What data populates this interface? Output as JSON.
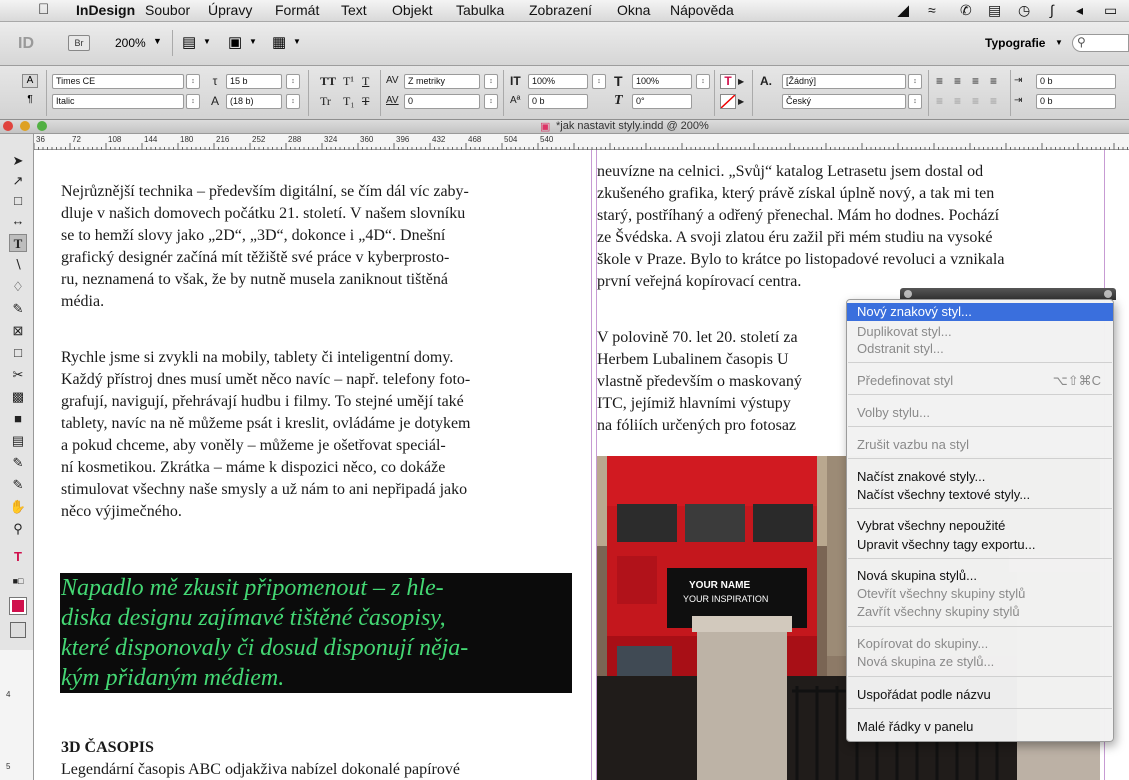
{
  "menubar": {
    "apple": "",
    "items": [
      "InDesign",
      "Soubor",
      "Úpravy",
      "Formát",
      "Text",
      "Objekt",
      "Tabulka",
      "Zobrazení",
      "Okna",
      "Nápověda"
    ]
  },
  "appbar": {
    "logo": "ID",
    "bridge": "Br",
    "zoom": "200%",
    "workspace": "Typografie",
    "search_icon": "search-icon"
  },
  "control": {
    "font_family": "Times CE",
    "font_style": "Italic",
    "size": "15 b",
    "leading": "(18 b)",
    "kerning": "Z metriky",
    "tracking": "0",
    "vscale": "100%",
    "baseline": "0 b",
    "hscale": "100%",
    "skew": "0°",
    "char_style": "[Žádný]",
    "language": "Český",
    "indent1": "0 b",
    "indent2": "0 b"
  },
  "document": {
    "tab_title": "*jak nastavit styly.indd @ 200%"
  },
  "ruler": {
    "ticks": [
      "36",
      "72",
      "108",
      "144",
      "180",
      "216",
      "252",
      "288",
      "324",
      "360",
      "396",
      "432",
      "468",
      "504",
      "540"
    ],
    "vticks": [
      "4",
      "5"
    ]
  },
  "left_column": {
    "para1": [
      "Nejrůznější technika – především digitální, se čím dál víc zaby-",
      "dluje v našich domovech počátku 21. století. V našem slovníku",
      "se to hemží slovy jako „2D“, „3D“, dokonce i „4D“. Dnešní",
      "grafický designér začíná mít těžiště své práce v kyberprosto-",
      "ru, neznamená to však, že by nutně musela zaniknout tištěná",
      "média."
    ],
    "para2": [
      "Rychle jsme si zvykli na mobily, tablety či inteligentní domy.",
      "Každý přístroj dnes musí umět něco navíc – např. telefony foto-",
      "grafují, navigují, přehrávají hudbu i filmy. To stejné umějí také",
      "tablety, navíc na ně můžeme psát i kreslit, ovládáme je dotykem",
      "a pokud chceme, aby voněly – můžeme je ošetřovat speciál-",
      "ní kosmetikou. Zkrátka – máme k dispozici něco, co dokáže",
      "stimulovat všechny naše smysly a už nám to ani nepřipadá jako",
      "něco výjimečného."
    ],
    "quote": [
      "Napadlo mě zkusit připomenout – z hle-",
      "diska designu zajímavé tištěné časopisy,",
      "které disponovaly či dosud disponují něja-",
      "kým přidaným médiem."
    ],
    "heading": "3D ČASOPIS",
    "para3": "Legendární časopis ABC odjakživa nabízel dokonalé papírové"
  },
  "right_column": {
    "para1": [
      "neuvízne na celnici. „Svůj“ katalog Letrasetu jsem dostal od",
      "zkušeného grafika, který právě získal úplně nový, a tak mi ten",
      "starý, postříhaný a odřený přenechal. Mám ho dodnes. Pochází",
      "ze Švédska. A svoji zlatou éru zažil při mém studiu na vysoké",
      "škole v Praze. Bylo to krátce po listopadové revoluci a vznikala",
      "první veřejná kopírovací centra."
    ],
    "para2": [
      "V polovině 70. let 20. století za",
      "Herbem Lubalinem  časopis U",
      "vlastně především o maskovaný",
      "ITC, jejímiž hlavními výstupy",
      "na fóliích určených pro fotosaz"
    ]
  },
  "photo": {
    "sign1": "YOUR NAME",
    "sign2": "YOUR INSPIRATION"
  },
  "menu": {
    "items": [
      {
        "label": "Nový znakový styl...",
        "shortcut": "",
        "enabled": true,
        "highlighted": true
      },
      {
        "label": "Duplikovat styl...",
        "shortcut": "",
        "enabled": false
      },
      {
        "label": "Odstranit styl...",
        "shortcut": "",
        "enabled": false
      },
      {
        "label": "Předefinovat styl",
        "shortcut": "⌥⇧⌘C",
        "enabled": false
      },
      {
        "label": "Volby stylu...",
        "shortcut": "",
        "enabled": false
      },
      {
        "label": "Zrušit vazbu na styl",
        "shortcut": "",
        "enabled": false
      },
      {
        "label": "Načíst znakové styly...",
        "shortcut": "",
        "enabled": true
      },
      {
        "label": "Načíst všechny textové styly...",
        "shortcut": "",
        "enabled": true
      },
      {
        "label": "Vybrat všechny nepoužité",
        "shortcut": "",
        "enabled": true
      },
      {
        "label": "Upravit všechny tagy exportu...",
        "shortcut": "",
        "enabled": true
      },
      {
        "label": "Nová skupina stylů...",
        "shortcut": "",
        "enabled": true
      },
      {
        "label": "Otevřít všechny skupiny stylů",
        "shortcut": "",
        "enabled": false
      },
      {
        "label": "Zavřít všechny skupiny stylů",
        "shortcut": "",
        "enabled": false
      },
      {
        "label": "Kopírovat do skupiny...",
        "shortcut": "",
        "enabled": false
      },
      {
        "label": "Nová skupina ze stylů...",
        "shortcut": "",
        "enabled": false
      },
      {
        "label": "Uspořádat podle názvu",
        "shortcut": "",
        "enabled": true
      },
      {
        "label": "Malé řádky v panelu",
        "shortcut": "",
        "enabled": true
      }
    ]
  }
}
